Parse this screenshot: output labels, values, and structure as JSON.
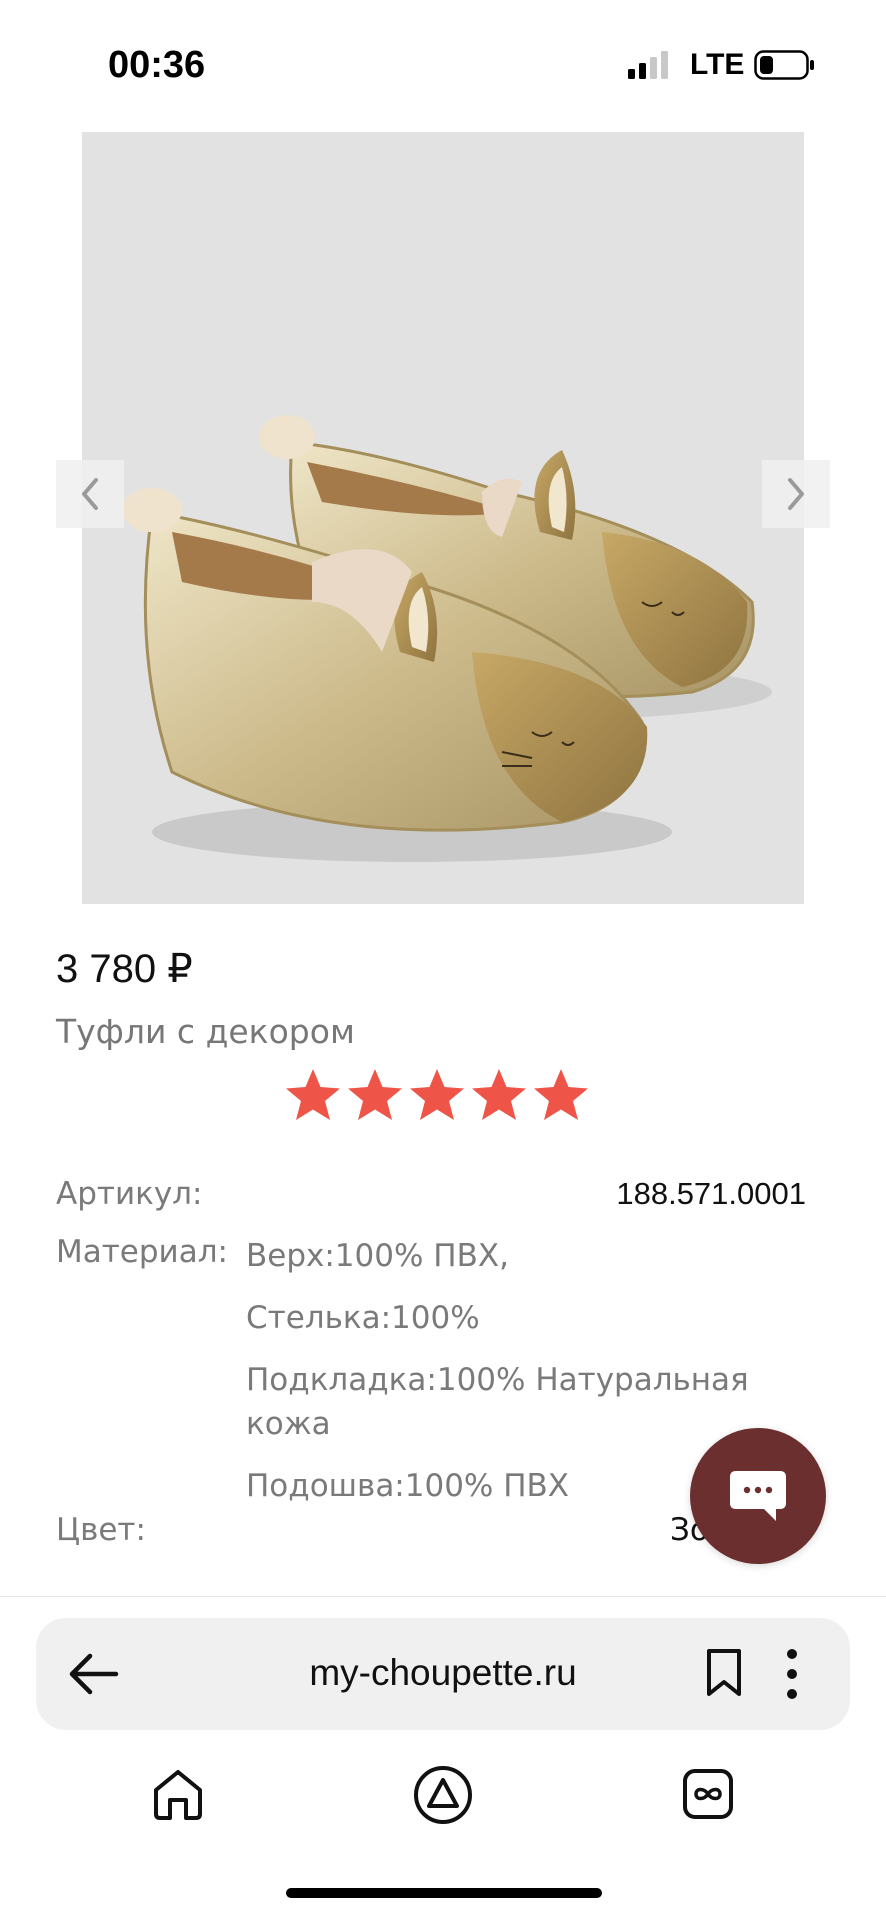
{
  "status_bar": {
    "time": "00:36",
    "network": "LTE",
    "icons": [
      "signal-icon",
      "battery-icon"
    ]
  },
  "gallery": {
    "image": "gold glitter bunny ballet flats",
    "prev_icon": "chevron-left-icon",
    "next_icon": "chevron-right-icon"
  },
  "product": {
    "price": "3 780 ₽",
    "name": "Туфли с декором",
    "rating": 5,
    "rating_max": 5,
    "star_color": "#ee5447"
  },
  "specs": {
    "article_label": "Артикул:",
    "article_value": "188.571.0001",
    "material_label": "Материал:",
    "material_lines": [
      "Верх:100% ПВХ,",
      "Стелька:100%",
      "Подкладка:100% Натуральная",
      "кожа",
      "Подошва:100% ПВХ"
    ],
    "color_label": "Цвет:",
    "color_value": "Золотой"
  },
  "chat": {
    "icon": "chat-bubble-icon",
    "color": "#6b2f2f"
  },
  "browser": {
    "url": "my-choupette.ru",
    "icons": [
      "back-arrow-icon",
      "bookmark-icon",
      "more-vertical-icon"
    ]
  },
  "bottom_nav": {
    "icons": [
      "home-icon",
      "alice-icon",
      "tabs-icon"
    ]
  }
}
